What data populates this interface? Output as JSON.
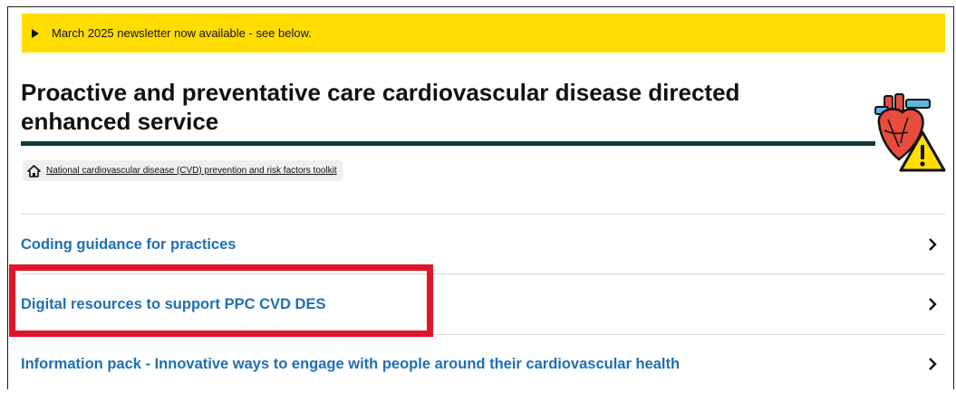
{
  "banner": {
    "text": "March 2025 newsletter now available - see below."
  },
  "page": {
    "title": "Proactive and preventative care cardiovascular disease directed enhanced service"
  },
  "toolkit": {
    "label": "National cardiovascular disease (CVD) prevention and risk factors toolkit"
  },
  "links": [
    {
      "label": "Coding guidance for practices"
    },
    {
      "label": "Digital resources to support PPC CVD DES"
    },
    {
      "label": "Information pack - Innovative ways to engage with people around their cardiovascular health"
    }
  ],
  "icons": {
    "hero": "heart-warning-icon",
    "toolkit": "house-icon",
    "row": "chevron-right-icon",
    "banner": "play-triangle-icon"
  },
  "colors": {
    "banner_bg": "#ffdd00",
    "link": "#1e6fb5",
    "rule": "#0e3a3a",
    "highlight": "#e0142a"
  }
}
